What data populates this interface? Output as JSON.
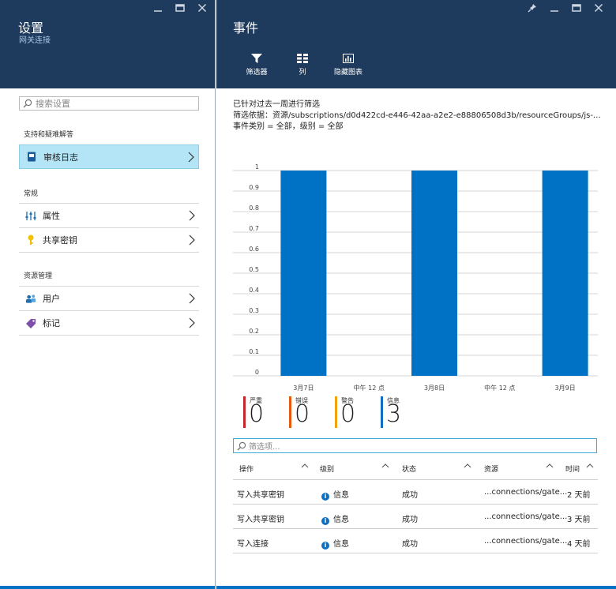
{
  "settings_blade": {
    "title": "设置",
    "subtitle": "网关连接",
    "search_placeholder": "搜索设置",
    "sections": [
      {
        "label": "支持和疑难解答",
        "items": [
          {
            "label": "审核日志",
            "icon": "audit-log-icon",
            "selected": true
          }
        ]
      },
      {
        "label": "常规",
        "items": [
          {
            "label": "属性",
            "icon": "properties-icon"
          },
          {
            "label": "共享密钥",
            "icon": "key-icon"
          }
        ]
      },
      {
        "label": "资源管理",
        "items": [
          {
            "label": "用户",
            "icon": "users-icon"
          },
          {
            "label": "标记",
            "icon": "tag-icon"
          }
        ]
      }
    ]
  },
  "events_blade": {
    "title": "事件",
    "toolbar": [
      {
        "label": "筛选器",
        "icon": "filter-icon"
      },
      {
        "label": "列",
        "icon": "columns-icon"
      },
      {
        "label": "隐藏图表",
        "icon": "chart-icon"
      }
    ],
    "filter_summary": {
      "line1": "已针对过去一周进行筛选",
      "line2": "筛选依据：资源/subscriptions/d0d422cd-e446-42aa-a2e2-e88806508d3b/resourceGroups/js-vpn-test-...",
      "line3": "事件类别 = 全部，级别 = 全部"
    },
    "stats": [
      {
        "label": "严重",
        "value": "0",
        "color": "#c4262e"
      },
      {
        "label": "错误",
        "value": "0",
        "color": "#e8590c"
      },
      {
        "label": "警告",
        "value": "0",
        "color": "#f0a30a"
      },
      {
        "label": "信息",
        "value": "3",
        "color": "#0e6fc2"
      }
    ],
    "filter_placeholder": "筛选项...",
    "table": {
      "headers": [
        "操作",
        "级别",
        "状态",
        "资源",
        "时间"
      ],
      "rows": [
        {
          "op": "写入共享密钥",
          "level": "信息",
          "status": "成功",
          "resource": "...connections/gate...",
          "time": "2 天前"
        },
        {
          "op": "写入共享密钥",
          "level": "信息",
          "status": "成功",
          "resource": "...connections/gate...",
          "time": "3 天前"
        },
        {
          "op": "写入连接",
          "level": "信息",
          "status": "成功",
          "resource": "...connections/gate...",
          "time": "4 天前"
        }
      ]
    }
  },
  "chart_data": {
    "type": "bar",
    "x_tick_labels": [
      "3月7日",
      "中午 12 点",
      "3月8日",
      "中午 12 点",
      "3月9日"
    ],
    "categories": [
      "3月7日",
      "3月8日",
      "3月9日"
    ],
    "values": [
      1,
      1,
      1
    ],
    "ylim": [
      0,
      1
    ],
    "y_ticks": [
      "0",
      "0.1",
      "0.2",
      "0.3",
      "0.4",
      "0.5",
      "0.6",
      "0.7",
      "0.8",
      "0.9",
      "1"
    ],
    "grid": true,
    "bar_color": "#0072c6"
  }
}
